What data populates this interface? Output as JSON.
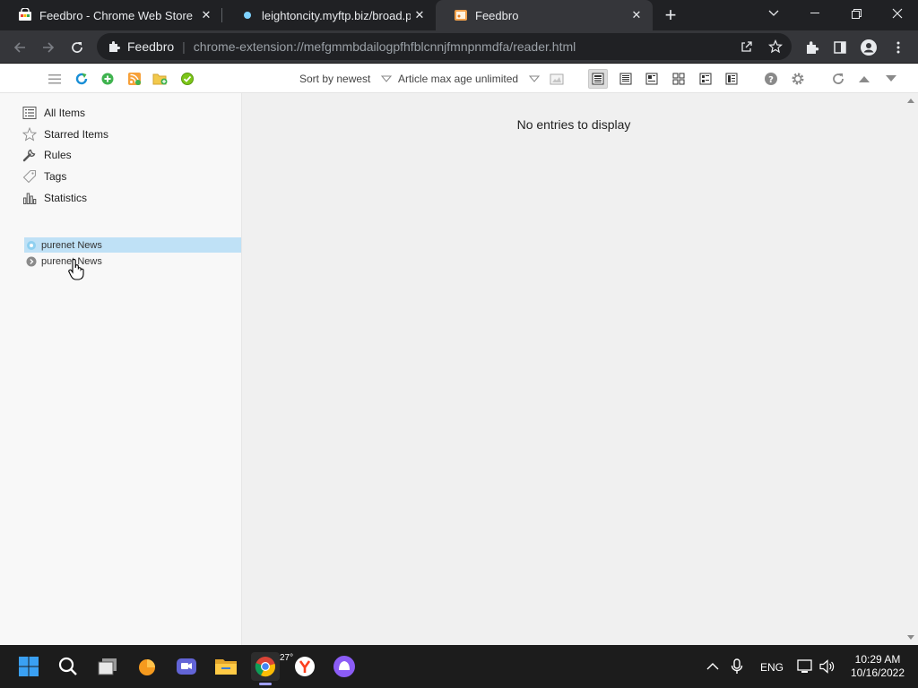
{
  "browser": {
    "tabs": [
      {
        "title": "Feedbro - Chrome Web Store",
        "active": false,
        "icon": "chrome-web-store-icon"
      },
      {
        "title": "leightoncity.myftp.biz/broad.php",
        "active": false,
        "icon": "globe-dot-icon"
      },
      {
        "title": "Feedbro",
        "active": true,
        "icon": "feedbro-icon"
      }
    ],
    "omnibox": {
      "site_label": "Feedbro",
      "url": "chrome-extension://mefgmmbdailogpfhfblcnnjfmnpnmdfa/reader.html"
    }
  },
  "toolbar": {
    "sort_label": "Sort by newest",
    "max_age_label": "Article max age unlimited"
  },
  "sidebar": {
    "nav": [
      {
        "label": "All Items",
        "icon": "list-icon"
      },
      {
        "label": "Starred Items",
        "icon": "star-icon"
      },
      {
        "label": "Rules",
        "icon": "wrench-icon"
      },
      {
        "label": "Tags",
        "icon": "tag-icon"
      },
      {
        "label": "Statistics",
        "icon": "bar-chart-icon"
      }
    ],
    "feeds": [
      {
        "label": "purenet News",
        "selected": true
      },
      {
        "label": "purenet News",
        "selected": false
      }
    ]
  },
  "main": {
    "empty_message": "No entries to display"
  },
  "taskbar": {
    "weather_temp": "27°",
    "language": "ENG",
    "time": "10:29 AM",
    "date": "10/16/2022"
  },
  "colors": {
    "chrome_dark": "#202124",
    "chrome_tab_active": "#35363a",
    "selection": "#bfe1f6",
    "main_bg": "#f0f0f0"
  }
}
